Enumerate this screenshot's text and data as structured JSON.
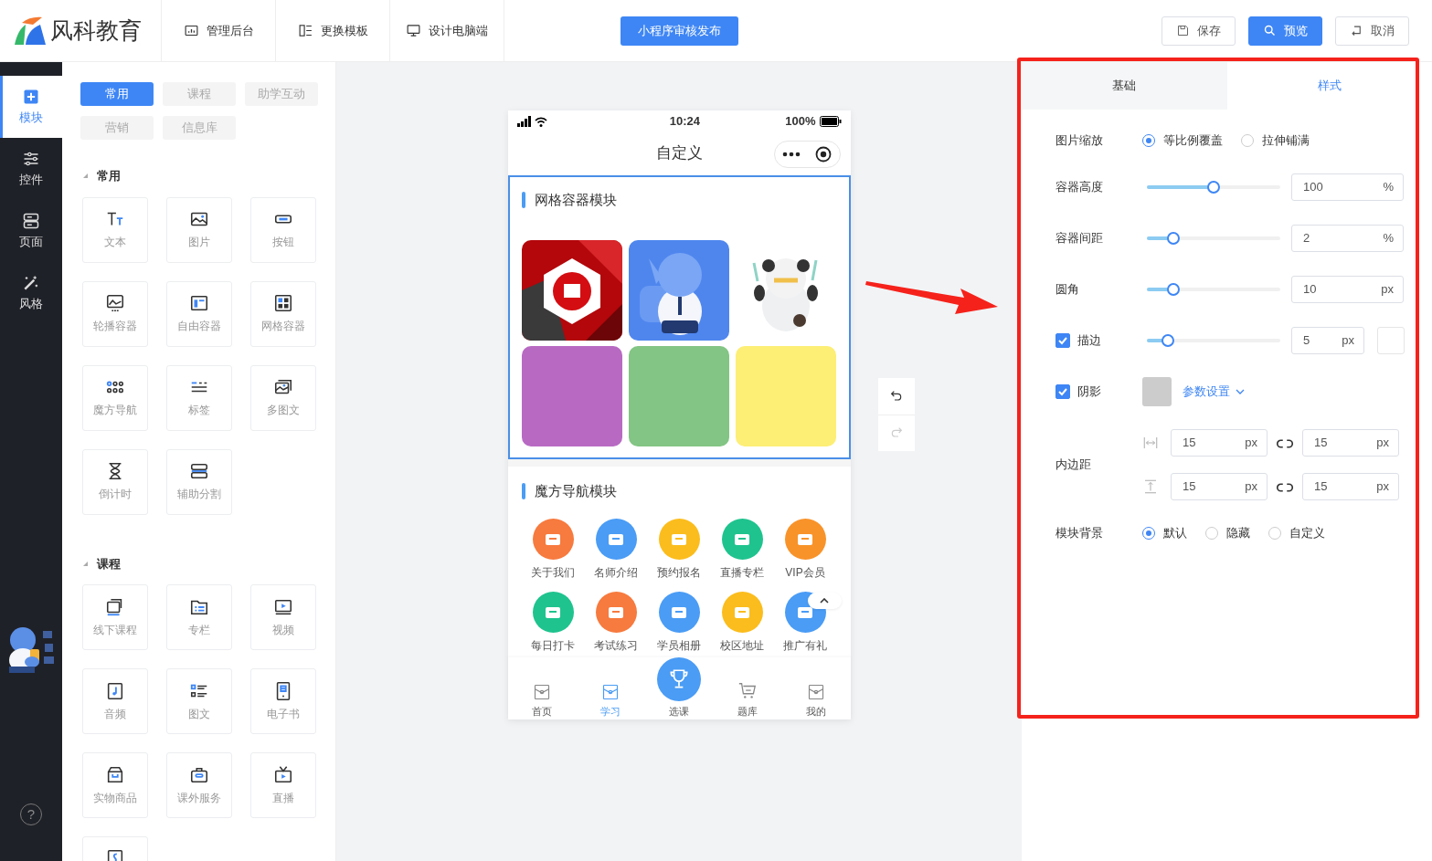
{
  "header": {
    "brand": "风科教育",
    "nav": [
      {
        "label": "管理后台"
      },
      {
        "label": "更换模板"
      },
      {
        "label": "设计电脑端"
      }
    ],
    "publish_button": "小程序审核发布",
    "actions": [
      {
        "label": "保存",
        "kind": "outline"
      },
      {
        "label": "预览",
        "kind": "primary"
      },
      {
        "label": "取消",
        "kind": "outline"
      }
    ]
  },
  "sidebar": {
    "items": [
      {
        "label": "模块",
        "selected": true
      },
      {
        "label": "控件",
        "selected": false
      },
      {
        "label": "页面",
        "selected": false
      },
      {
        "label": "风格",
        "selected": false
      }
    ],
    "help": "?"
  },
  "component_panel": {
    "tabs": [
      {
        "label": "常用",
        "selected": true
      },
      {
        "label": "课程",
        "selected": false
      },
      {
        "label": "助学互动",
        "selected": false
      },
      {
        "label": "营销",
        "selected": false
      },
      {
        "label": "信息库",
        "selected": false
      }
    ],
    "sections": [
      {
        "title": "常用",
        "items": [
          "文本",
          "图片",
          "按钮",
          "轮播容器",
          "自由容器",
          "网格容器",
          "魔方导航",
          "标签",
          "多图文",
          "倒计时",
          "辅助分割"
        ],
        "more_below": false
      },
      {
        "title": "课程",
        "items": [
          "线下课程",
          "专栏",
          "视频",
          "音频",
          "图文",
          "电子书",
          "实物商品",
          "课外服务",
          "直播"
        ],
        "more_below": true
      }
    ]
  },
  "phone": {
    "status": {
      "time": "10:24",
      "battery": "100%"
    },
    "title": "自定义",
    "modules": [
      {
        "kind": "grid",
        "title": "网格容器模块",
        "selected": true,
        "cells": [
          {
            "kind": "picture"
          },
          {
            "kind": "picture"
          },
          {
            "kind": "picture"
          },
          {
            "kind": "color",
            "color": "#b86ac3"
          },
          {
            "kind": "color",
            "color": "#83c584"
          },
          {
            "kind": "color",
            "color": "#fdee76"
          }
        ]
      },
      {
        "kind": "nav",
        "title": "魔方导航模块",
        "selected": false,
        "items": [
          {
            "label": "关于我们",
            "color": "#f77a3e"
          },
          {
            "label": "名师介绍",
            "color": "#4a9cf5"
          },
          {
            "label": "预约报名",
            "color": "#fbbd1d"
          },
          {
            "label": "直播专栏",
            "color": "#1fc38e"
          },
          {
            "label": "VIP会员",
            "color": "#f8932a"
          },
          {
            "label": "每日打卡",
            "color": "#1fc38e"
          },
          {
            "label": "考试练习",
            "color": "#f77a3e"
          },
          {
            "label": "学员相册",
            "color": "#4a9cf5"
          },
          {
            "label": "校区地址",
            "color": "#fbbd1d"
          },
          {
            "label": "推广有礼",
            "color": "#4a9cf5"
          }
        ]
      }
    ],
    "tabbar": [
      {
        "label": "首页",
        "kind": "tab",
        "selected": false
      },
      {
        "label": "学习",
        "kind": "tab",
        "selected": true
      },
      {
        "label": "选课",
        "kind": "center",
        "selected": false
      },
      {
        "label": "题库",
        "kind": "tab",
        "selected": false
      },
      {
        "label": "我的",
        "kind": "tab",
        "selected": false
      }
    ]
  },
  "settings": {
    "tabs": [
      {
        "label": "基础",
        "selected": false
      },
      {
        "label": "样式",
        "selected": true
      }
    ],
    "rows": [
      {
        "kind": "radio",
        "label": "图片缩放",
        "options": [
          {
            "label": "等比例覆盖",
            "selected": true
          },
          {
            "label": "拉伸铺满",
            "selected": false
          }
        ]
      },
      {
        "kind": "slider",
        "label": "容器高度",
        "level": 0.5,
        "value": "100",
        "unit": "%"
      },
      {
        "kind": "slider",
        "label": "容器间距",
        "level": 0.2,
        "value": "2",
        "unit": "%"
      },
      {
        "kind": "slider",
        "label": "圆角",
        "level": 0.2,
        "value": "10",
        "unit": "px"
      },
      {
        "kind": "slider",
        "label": "描边",
        "checked": true,
        "level": 0.16,
        "value": "5",
        "unit": "px"
      },
      {
        "kind": "shadow",
        "label": "阴影",
        "checked": true,
        "link": "参数设置"
      },
      {
        "kind": "padding",
        "label": "内边距",
        "fields": [
          {
            "value": "15",
            "unit": "px"
          },
          {
            "value": "15",
            "unit": "px"
          },
          {
            "value": "15",
            "unit": "px"
          },
          {
            "value": "15",
            "unit": "px"
          }
        ]
      },
      {
        "kind": "radio",
        "label": "模块背景",
        "options": [
          {
            "label": "默认",
            "selected": true
          },
          {
            "label": "隐藏",
            "selected": false
          },
          {
            "label": "自定义",
            "selected": false
          }
        ]
      }
    ]
  }
}
